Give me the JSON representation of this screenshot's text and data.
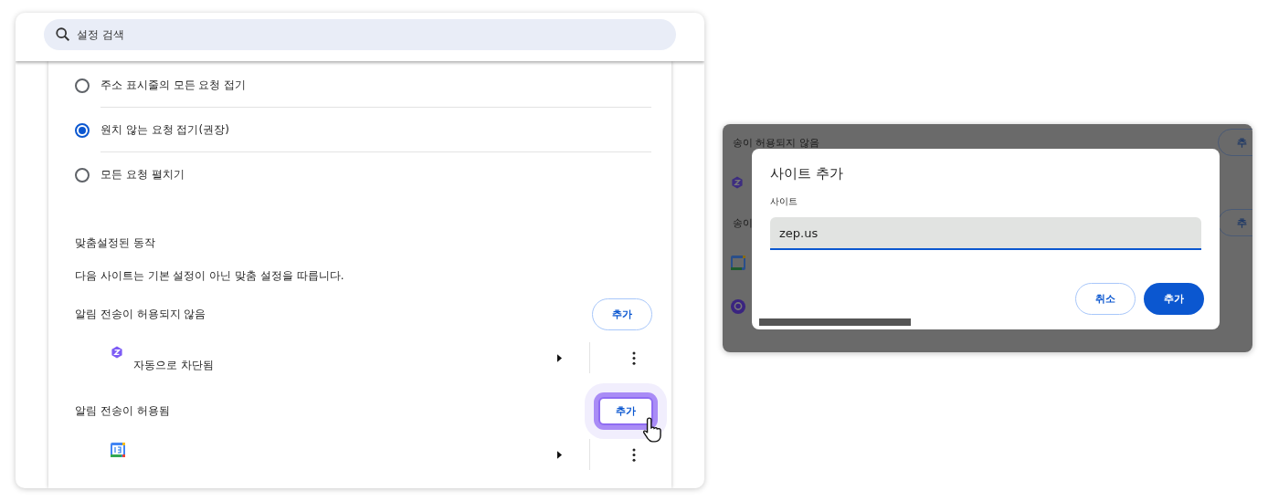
{
  "search": {
    "placeholder": "설정 검색"
  },
  "radio_options": [
    {
      "label": "주소 표시줄의 모든 요청 접기",
      "selected": false
    },
    {
      "label": "원치 않는 요청 접기(권장)",
      "selected": true
    },
    {
      "label": "모든 요청 펼치기",
      "selected": false
    }
  ],
  "section_title": "맞춤설정된 동작",
  "description": "다음 사이트는 기본 설정이 아닌 맞춤 설정을 따릅니다.",
  "groups": [
    {
      "title": "알림 전송이 허용되지 않음",
      "button": "추가",
      "highlighted": false,
      "sites": [
        {
          "kind": "zep",
          "subtitle": "자동으로 차단됨"
        }
      ]
    },
    {
      "title": "알림 전송이 허용됨",
      "button": "추가",
      "highlighted": true,
      "sites": [
        {
          "kind": "calendar"
        }
      ]
    }
  ],
  "dialog_view": {
    "background_rows": [
      {
        "kind": "heading",
        "text": "송이 허용되지 않음",
        "button": "추"
      },
      {
        "kind": "zep_site"
      },
      {
        "kind": "heading",
        "text": "송이",
        "button": "추"
      },
      {
        "kind": "calendar_site"
      },
      {
        "kind": "chat_site"
      }
    ],
    "dialog": {
      "title": "사이트 추가",
      "field_label": "사이트",
      "field_value": "zep.us",
      "buttons": [
        {
          "label": "취소",
          "kind": "secondary"
        },
        {
          "label": "추가",
          "kind": "primary"
        }
      ]
    }
  }
}
